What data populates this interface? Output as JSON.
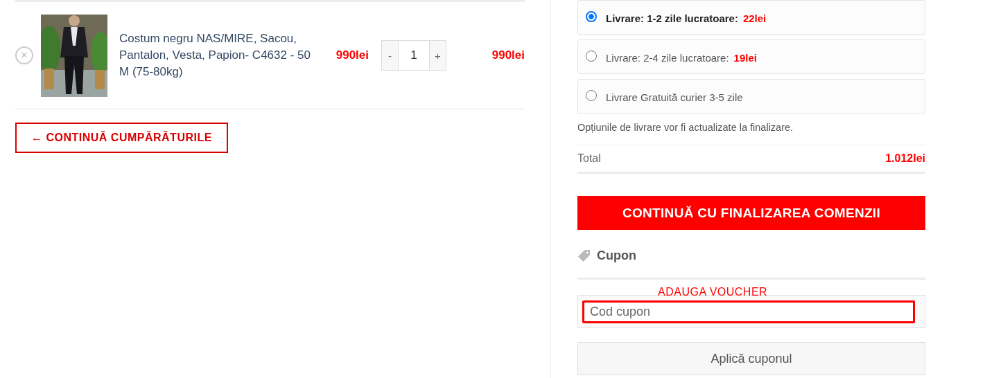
{
  "cart_items": [
    {
      "remove": "×",
      "name": "Costum negru NAS/MIRE, Sacou, Pantalon, Vesta, Papion- C4632 - 50 M (75-80kg)",
      "price": "990lei",
      "quantity": "1",
      "decrement": "-",
      "increment": "+",
      "subtotal": "990lei"
    }
  ],
  "continue_shopping": "← CONTINUĂ CUMPĂRĂTURILE",
  "shipping_options": [
    {
      "label": "Livrare: 1-2 zile lucratoare:",
      "price": "22lei",
      "selected": true
    },
    {
      "label": "Livrare: 2-4 zile lucratoare:",
      "price": "19lei",
      "selected": false
    },
    {
      "label": "Livrare Gratuită curier 3-5 zile",
      "selected": false
    }
  ],
  "shipping_note": "Opțiunile de livrare vor fi actualizate la finalizare.",
  "total": {
    "label": "Total",
    "value": "1.012lei"
  },
  "checkout_button": "CONTINUĂ CU FINALIZAREA COMENZII",
  "coupon": {
    "title": "Cupon",
    "annotation": "ADAUGA VOUCHER",
    "placeholder": "Cod cupon",
    "apply_button": "Aplică cuponul"
  }
}
